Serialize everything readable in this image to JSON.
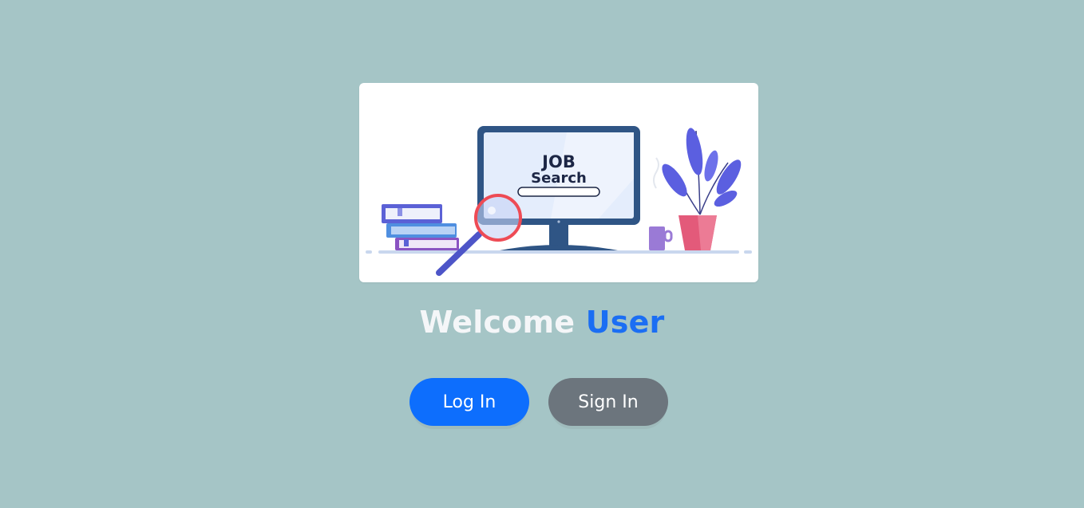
{
  "hero": {
    "image_name": "job-search-illustration",
    "screen_title": "JOB",
    "screen_subtitle": "Search"
  },
  "welcome": {
    "prefix": "Welcome",
    "name": "User"
  },
  "actions": {
    "login_label": "Log In",
    "signin_label": "Sign In"
  },
  "colors": {
    "background": "#a5c5c6",
    "primary": "#0d6efd",
    "secondary": "#6c757d",
    "accent_text": "#1b6ef3"
  }
}
